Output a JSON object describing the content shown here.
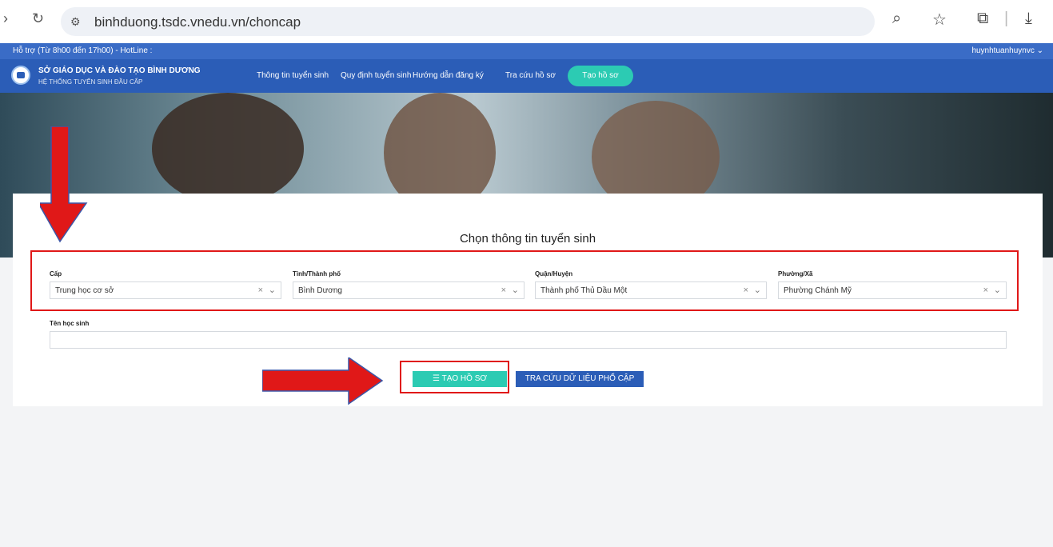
{
  "browser": {
    "url": "binhduong.tsdc.vnedu.vn/choncap",
    "site_info_icon": "tune-icon"
  },
  "support": {
    "text": "Hỗ trợ (Từ 8h00 đến 17h00) - HotLine :",
    "user": "huynhtuanhuynvc ⌄"
  },
  "header": {
    "title": "SỞ GIÁO DỤC VÀ ĐÀO TẠO BÌNH DƯƠNG",
    "subtitle": "HỆ THỐNG TUYỂN SINH ĐẦU CẤP",
    "menu": [
      {
        "label": "Thông tin tuyển sinh"
      },
      {
        "label": "Quy định tuyển sinh"
      },
      {
        "label": "Hướng dẫn đăng ký"
      },
      {
        "label": "Tra cứu hồ sơ"
      }
    ],
    "cta": "Tạo hồ sơ"
  },
  "form": {
    "title": "Chọn thông tin tuyển sinh",
    "fields": [
      {
        "label": "Cấp",
        "value": "Trung học cơ sở"
      },
      {
        "label": "Tỉnh/Thành phố",
        "value": "Bình Dương"
      },
      {
        "label": "Quận/Huyện",
        "value": "Thành phố Thủ Dầu Một"
      },
      {
        "label": "Phường/Xã",
        "value": "Phường Chánh Mỹ"
      }
    ],
    "student_label": "Tên học sinh",
    "student_value": "",
    "create_button": "☰ TẠO HỒ SƠ",
    "lookup_button": "TRA CỨU DỮ LIỆU PHỔ CẬP"
  },
  "colors": {
    "header_blue": "#2b5db7",
    "accent_teal": "#2ccbb3",
    "annotation_red": "#e01818"
  }
}
